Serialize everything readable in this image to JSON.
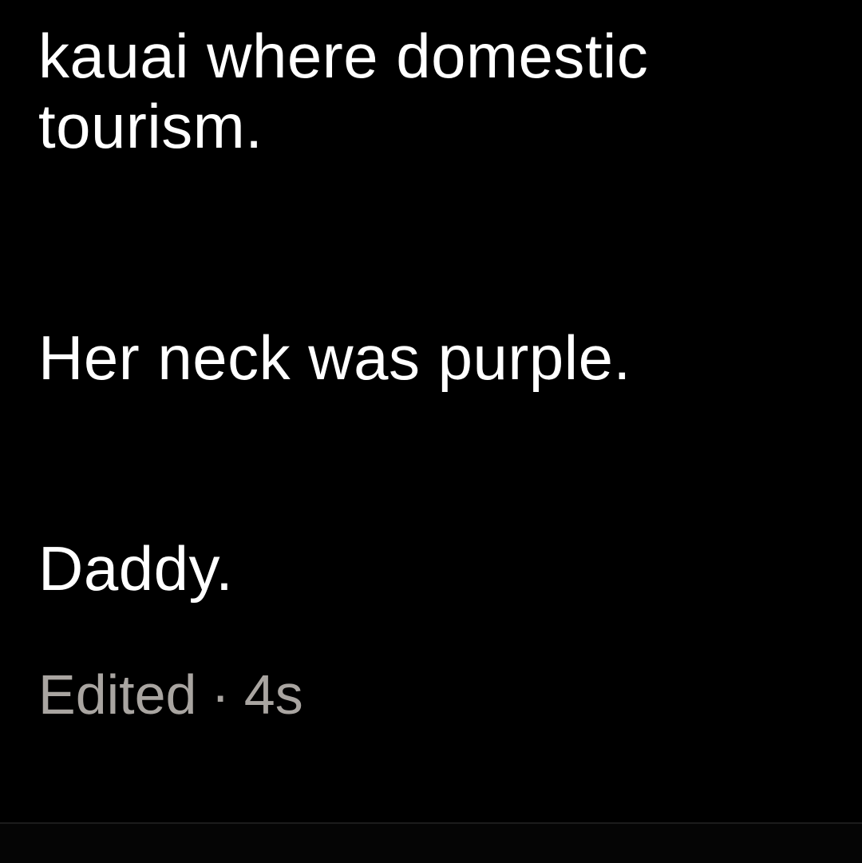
{
  "post": {
    "paragraphs": [
      [
        "kauai where domestic",
        "tourism."
      ],
      [
        "Her neck was purple."
      ],
      [
        "Daddy."
      ]
    ],
    "meta": {
      "edited_label": "Edited",
      "separator": "·",
      "age": "4s"
    }
  },
  "colors": {
    "background": "#000000",
    "text": "#ffffff",
    "meta_text": "#a9a5a1"
  }
}
